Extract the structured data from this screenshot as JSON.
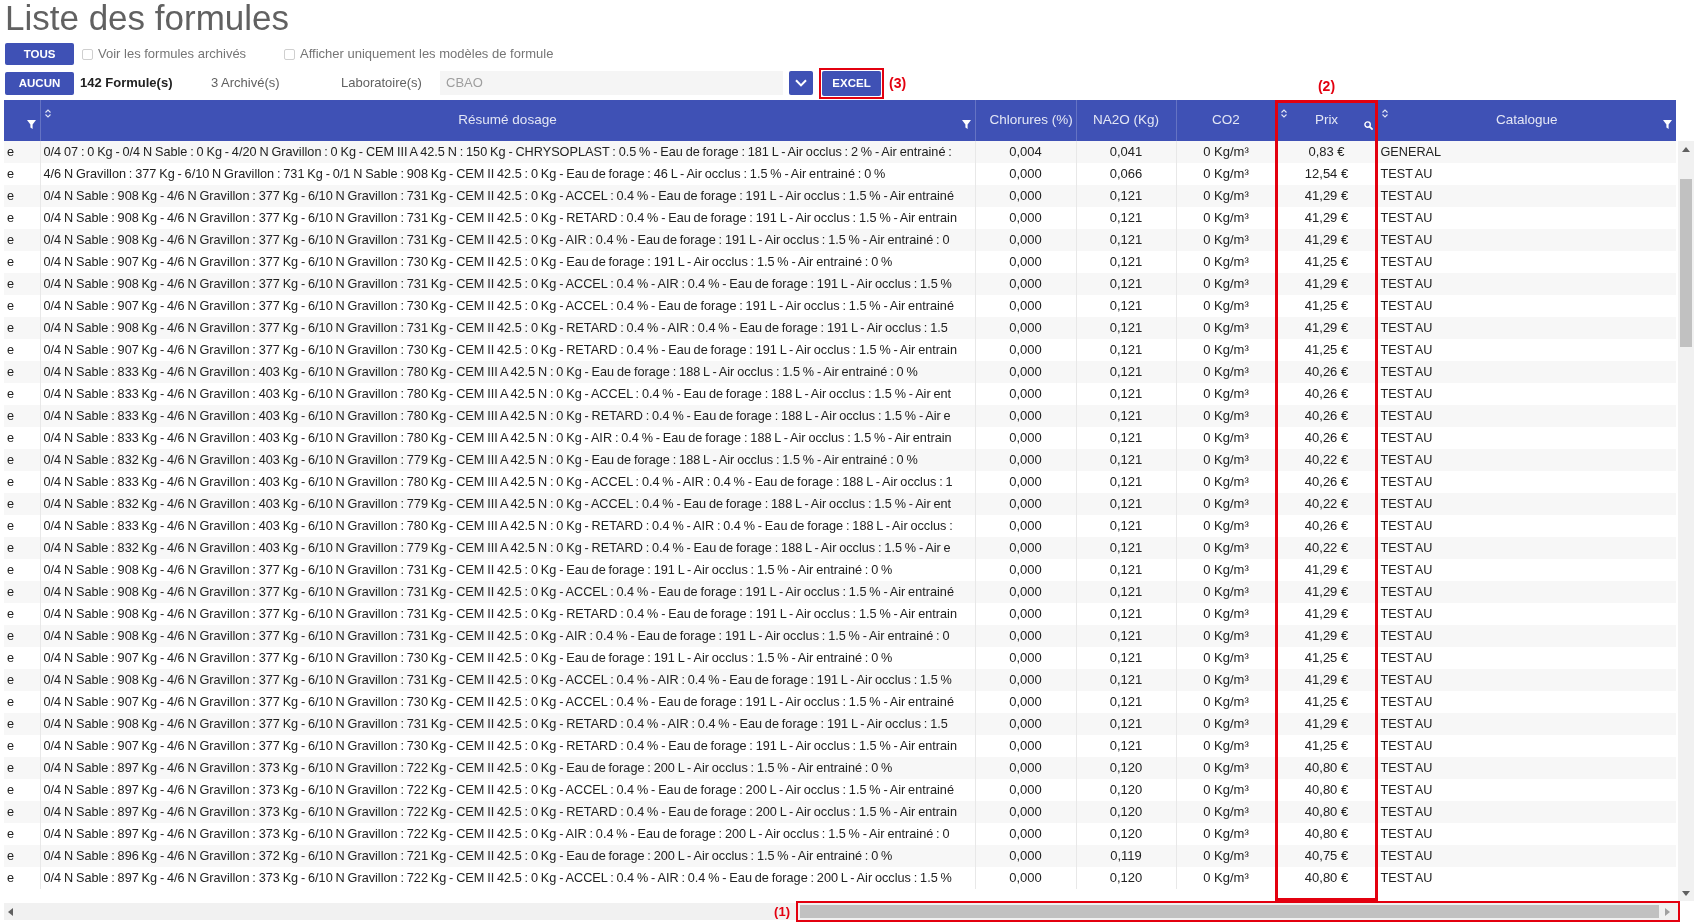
{
  "title": "Liste des formules",
  "toolbar_row_1": {
    "button": "TOUS",
    "checkboxes": [
      {
        "label": "Voir les formules archivés",
        "checked": false
      },
      {
        "label": "Afficher uniquement les modèles de formule",
        "checked": false
      }
    ]
  },
  "toolbar_row_2": {
    "button": "AUCUN",
    "formula_count": "142 Formule(s)",
    "archived_count": "3 Archivé(s)",
    "laboratory": {
      "label": "Laboratoire(s)",
      "value": "CBAO"
    },
    "export_button": {
      "label": "EXCEL",
      "annotation": "(3)"
    }
  },
  "table": {
    "columns": [
      {
        "kind": "text",
        "sortable": false,
        "filter": true,
        "search": false
      },
      {
        "label": "Résumé dosage",
        "kind": "text",
        "sortable": true,
        "filter": true,
        "search": false
      },
      {
        "label": "Chlorures (%)",
        "kind": "number",
        "sortable": false,
        "filter": false,
        "search": false
      },
      {
        "label": "NA2O (Kg)",
        "kind": "number",
        "sortable": false,
        "filter": false,
        "search": false
      },
      {
        "label": "CO2",
        "kind": "number",
        "sortable": false,
        "filter": false,
        "search": false
      },
      {
        "label": "Prix",
        "kind": "number",
        "sortable": true,
        "filter": false,
        "search": true,
        "annotation": "(2)"
      },
      {
        "label": "Catalogue",
        "kind": "text",
        "sortable": true,
        "filter": true,
        "search": false
      }
    ],
    "rows": [
      [
        "e",
        "0/4 07 : 0 Kg - 0/4 N Sable : 0 Kg - 4/20 N Gravillon : 0 Kg - CEM III A 42.5 N : 150 Kg - CHRYSOPLAST : 0.5 % - Eau de forage : 181 L - Air occlus : 2 % - Air entrainé :",
        "0,004",
        "0,041",
        "0 Kg/m³",
        "0,83 €",
        "GENERAL"
      ],
      [
        "e",
        "4/6 N Gravillon : 377 Kg - 6/10 N Gravillon : 731 Kg - 0/1 N Sable : 908 Kg - CEM II 42.5 : 0 Kg - Eau de forage : 46 L - Air occlus : 1.5 % - Air entrainé : 0 %",
        "0,000",
        "0,066",
        "0 Kg/m³",
        "12,54 €",
        "TEST AU"
      ],
      [
        "e",
        "0/4 N Sable : 908 Kg - 4/6 N Gravillon : 377 Kg - 6/10 N Gravillon : 731 Kg - CEM II 42.5 : 0 Kg - ACCEL : 0.4 % - Eau de forage : 191 L - Air occlus : 1.5 % - Air entrainé",
        "0,000",
        "0,121",
        "0 Kg/m³",
        "41,29 €",
        "TEST AU"
      ],
      [
        "e",
        "0/4 N Sable : 908 Kg - 4/6 N Gravillon : 377 Kg - 6/10 N Gravillon : 731 Kg - CEM II 42.5 : 0 Kg - RETARD : 0.4 % - Eau de forage : 191 L - Air occlus : 1.5 % - Air entrain",
        "0,000",
        "0,121",
        "0 Kg/m³",
        "41,29 €",
        "TEST AU"
      ],
      [
        "e",
        "0/4 N Sable : 908 Kg - 4/6 N Gravillon : 377 Kg - 6/10 N Gravillon : 731 Kg - CEM II 42.5 : 0 Kg - AIR : 0.4 % - Eau de forage : 191 L - Air occlus : 1.5 % - Air entrainé : 0",
        "0,000",
        "0,121",
        "0 Kg/m³",
        "41,29 €",
        "TEST AU"
      ],
      [
        "e",
        "0/4 N Sable : 907 Kg - 4/6 N Gravillon : 377 Kg - 6/10 N Gravillon : 730 Kg - CEM II 42.5 : 0 Kg - Eau de forage : 191 L - Air occlus : 1.5 % - Air entrainé : 0 %",
        "0,000",
        "0,121",
        "0 Kg/m³",
        "41,25 €",
        "TEST AU"
      ],
      [
        "e",
        "0/4 N Sable : 908 Kg - 4/6 N Gravillon : 377 Kg - 6/10 N Gravillon : 731 Kg - CEM II 42.5 : 0 Kg - ACCEL : 0.4 % - AIR : 0.4 % - Eau de forage : 191 L - Air occlus : 1.5 %",
        "0,000",
        "0,121",
        "0 Kg/m³",
        "41,29 €",
        "TEST AU"
      ],
      [
        "e",
        "0/4 N Sable : 907 Kg - 4/6 N Gravillon : 377 Kg - 6/10 N Gravillon : 730 Kg - CEM II 42.5 : 0 Kg - ACCEL : 0.4 % - Eau de forage : 191 L - Air occlus : 1.5 % - Air entrainé",
        "0,000",
        "0,121",
        "0 Kg/m³",
        "41,25 €",
        "TEST AU"
      ],
      [
        "e",
        "0/4 N Sable : 908 Kg - 4/6 N Gravillon : 377 Kg - 6/10 N Gravillon : 731 Kg - CEM II 42.5 : 0 Kg - RETARD : 0.4 % - AIR : 0.4 % - Eau de forage : 191 L - Air occlus : 1.5",
        "0,000",
        "0,121",
        "0 Kg/m³",
        "41,29 €",
        "TEST AU"
      ],
      [
        "e",
        "0/4 N Sable : 907 Kg - 4/6 N Gravillon : 377 Kg - 6/10 N Gravillon : 730 Kg - CEM II 42.5 : 0 Kg - RETARD : 0.4 % - Eau de forage : 191 L - Air occlus : 1.5 % - Air entrain",
        "0,000",
        "0,121",
        "0 Kg/m³",
        "41,25 €",
        "TEST AU"
      ],
      [
        "e",
        "0/4 N Sable : 833 Kg - 4/6 N Gravillon : 403 Kg - 6/10 N Gravillon : 780 Kg - CEM III A 42.5 N : 0 Kg - Eau de forage : 188 L - Air occlus : 1.5 % - Air entrainé : 0 %",
        "0,000",
        "0,121",
        "0 Kg/m³",
        "40,26 €",
        "TEST AU"
      ],
      [
        "e",
        "0/4 N Sable : 833 Kg - 4/6 N Gravillon : 403 Kg - 6/10 N Gravillon : 780 Kg - CEM III A 42.5 N : 0 Kg - ACCEL : 0.4 % - Eau de forage : 188 L - Air occlus : 1.5 % - Air ent",
        "0,000",
        "0,121",
        "0 Kg/m³",
        "40,26 €",
        "TEST AU"
      ],
      [
        "e",
        "0/4 N Sable : 833 Kg - 4/6 N Gravillon : 403 Kg - 6/10 N Gravillon : 780 Kg - CEM III A 42.5 N : 0 Kg - RETARD : 0.4 % - Eau de forage : 188 L - Air occlus : 1.5 % - Air e",
        "0,000",
        "0,121",
        "0 Kg/m³",
        "40,26 €",
        "TEST AU"
      ],
      [
        "e",
        "0/4 N Sable : 833 Kg - 4/6 N Gravillon : 403 Kg - 6/10 N Gravillon : 780 Kg - CEM III A 42.5 N : 0 Kg - AIR : 0.4 % - Eau de forage : 188 L - Air occlus : 1.5 % - Air entrain",
        "0,000",
        "0,121",
        "0 Kg/m³",
        "40,26 €",
        "TEST AU"
      ],
      [
        "e",
        "0/4 N Sable : 832 Kg - 4/6 N Gravillon : 403 Kg - 6/10 N Gravillon : 779 Kg - CEM III A 42.5 N : 0 Kg - Eau de forage : 188 L - Air occlus : 1.5 % - Air entrainé : 0 %",
        "0,000",
        "0,121",
        "0 Kg/m³",
        "40,22 €",
        "TEST AU"
      ],
      [
        "e",
        "0/4 N Sable : 833 Kg - 4/6 N Gravillon : 403 Kg - 6/10 N Gravillon : 780 Kg - CEM III A 42.5 N : 0 Kg - ACCEL : 0.4 % - AIR : 0.4 % - Eau de forage : 188 L - Air occlus : 1",
        "0,000",
        "0,121",
        "0 Kg/m³",
        "40,26 €",
        "TEST AU"
      ],
      [
        "e",
        "0/4 N Sable : 832 Kg - 4/6 N Gravillon : 403 Kg - 6/10 N Gravillon : 779 Kg - CEM III A 42.5 N : 0 Kg - ACCEL : 0.4 % - Eau de forage : 188 L - Air occlus : 1.5 % - Air ent",
        "0,000",
        "0,121",
        "0 Kg/m³",
        "40,22 €",
        "TEST AU"
      ],
      [
        "e",
        "0/4 N Sable : 833 Kg - 4/6 N Gravillon : 403 Kg - 6/10 N Gravillon : 780 Kg - CEM III A 42.5 N : 0 Kg - RETARD : 0.4 % - AIR : 0.4 % - Eau de forage : 188 L - Air occlus :",
        "0,000",
        "0,121",
        "0 Kg/m³",
        "40,26 €",
        "TEST AU"
      ],
      [
        "e",
        "0/4 N Sable : 832 Kg - 4/6 N Gravillon : 403 Kg - 6/10 N Gravillon : 779 Kg - CEM III A 42.5 N : 0 Kg - RETARD : 0.4 % - Eau de forage : 188 L - Air occlus : 1.5 % - Air e",
        "0,000",
        "0,121",
        "0 Kg/m³",
        "40,22 €",
        "TEST AU"
      ],
      [
        "e",
        "0/4 N Sable : 908 Kg - 4/6 N Gravillon : 377 Kg - 6/10 N Gravillon : 731 Kg - CEM II 42.5 : 0 Kg - Eau de forage : 191 L - Air occlus : 1.5 % - Air entrainé : 0 %",
        "0,000",
        "0,121",
        "0 Kg/m³",
        "41,29 €",
        "TEST AU"
      ],
      [
        "e",
        "0/4 N Sable : 908 Kg - 4/6 N Gravillon : 377 Kg - 6/10 N Gravillon : 731 Kg - CEM II 42.5 : 0 Kg - ACCEL : 0.4 % - Eau de forage : 191 L - Air occlus : 1.5 % - Air entrainé",
        "0,000",
        "0,121",
        "0 Kg/m³",
        "41,29 €",
        "TEST AU"
      ],
      [
        "e",
        "0/4 N Sable : 908 Kg - 4/6 N Gravillon : 377 Kg - 6/10 N Gravillon : 731 Kg - CEM II 42.5 : 0 Kg - RETARD : 0.4 % - Eau de forage : 191 L - Air occlus : 1.5 % - Air entrain",
        "0,000",
        "0,121",
        "0 Kg/m³",
        "41,29 €",
        "TEST AU"
      ],
      [
        "e",
        "0/4 N Sable : 908 Kg - 4/6 N Gravillon : 377 Kg - 6/10 N Gravillon : 731 Kg - CEM II 42.5 : 0 Kg - AIR : 0.4 % - Eau de forage : 191 L - Air occlus : 1.5 % - Air entrainé : 0",
        "0,000",
        "0,121",
        "0 Kg/m³",
        "41,29 €",
        "TEST AU"
      ],
      [
        "e",
        "0/4 N Sable : 907 Kg - 4/6 N Gravillon : 377 Kg - 6/10 N Gravillon : 730 Kg - CEM II 42.5 : 0 Kg - Eau de forage : 191 L - Air occlus : 1.5 % - Air entrainé : 0 %",
        "0,000",
        "0,121",
        "0 Kg/m³",
        "41,25 €",
        "TEST AU"
      ],
      [
        "e",
        "0/4 N Sable : 908 Kg - 4/6 N Gravillon : 377 Kg - 6/10 N Gravillon : 731 Kg - CEM II 42.5 : 0 Kg - ACCEL : 0.4 % - AIR : 0.4 % - Eau de forage : 191 L - Air occlus : 1.5 %",
        "0,000",
        "0,121",
        "0 Kg/m³",
        "41,29 €",
        "TEST AU"
      ],
      [
        "e",
        "0/4 N Sable : 907 Kg - 4/6 N Gravillon : 377 Kg - 6/10 N Gravillon : 730 Kg - CEM II 42.5 : 0 Kg - ACCEL : 0.4 % - Eau de forage : 191 L - Air occlus : 1.5 % - Air entrainé",
        "0,000",
        "0,121",
        "0 Kg/m³",
        "41,25 €",
        "TEST AU"
      ],
      [
        "e",
        "0/4 N Sable : 908 Kg - 4/6 N Gravillon : 377 Kg - 6/10 N Gravillon : 731 Kg - CEM II 42.5 : 0 Kg - RETARD : 0.4 % - AIR : 0.4 % - Eau de forage : 191 L - Air occlus : 1.5",
        "0,000",
        "0,121",
        "0 Kg/m³",
        "41,29 €",
        "TEST AU"
      ],
      [
        "e",
        "0/4 N Sable : 907 Kg - 4/6 N Gravillon : 377 Kg - 6/10 N Gravillon : 730 Kg - CEM II 42.5 : 0 Kg - RETARD : 0.4 % - Eau de forage : 191 L - Air occlus : 1.5 % - Air entrain",
        "0,000",
        "0,121",
        "0 Kg/m³",
        "41,25 €",
        "TEST AU"
      ],
      [
        "e",
        "0/4 N Sable : 897 Kg - 4/6 N Gravillon : 373 Kg - 6/10 N Gravillon : 722 Kg - CEM II 42.5 : 0 Kg - Eau de forage : 200 L - Air occlus : 1.5 % - Air entrainé : 0 %",
        "0,000",
        "0,120",
        "0 Kg/m³",
        "40,80 €",
        "TEST AU"
      ],
      [
        "e",
        "0/4 N Sable : 897 Kg - 4/6 N Gravillon : 373 Kg - 6/10 N Gravillon : 722 Kg - CEM II 42.5 : 0 Kg - ACCEL : 0.4 % - Eau de forage : 200 L - Air occlus : 1.5 % - Air entrainé",
        "0,000",
        "0,120",
        "0 Kg/m³",
        "40,80 €",
        "TEST AU"
      ],
      [
        "e",
        "0/4 N Sable : 897 Kg - 4/6 N Gravillon : 373 Kg - 6/10 N Gravillon : 722 Kg - CEM II 42.5 : 0 Kg - RETARD : 0.4 % - Eau de forage : 200 L - Air occlus : 1.5 % - Air entrain",
        "0,000",
        "0,120",
        "0 Kg/m³",
        "40,80 €",
        "TEST AU"
      ],
      [
        "e",
        "0/4 N Sable : 897 Kg - 4/6 N Gravillon : 373 Kg - 6/10 N Gravillon : 722 Kg - CEM II 42.5 : 0 Kg - AIR : 0.4 % - Eau de forage : 200 L - Air occlus : 1.5 % - Air entrainé : 0",
        "0,000",
        "0,120",
        "0 Kg/m³",
        "40,80 €",
        "TEST AU"
      ],
      [
        "e",
        "0/4 N Sable : 896 Kg - 4/6 N Gravillon : 372 Kg - 6/10 N Gravillon : 721 Kg - CEM II 42.5 : 0 Kg - Eau de forage : 200 L - Air occlus : 1.5 % - Air entrainé : 0 %",
        "0,000",
        "0,119",
        "0 Kg/m³",
        "40,75 €",
        "TEST AU"
      ],
      [
        "e",
        "0/4 N Sable : 897 Kg - 4/6 N Gravillon : 373 Kg - 6/10 N Gravillon : 722 Kg - CEM II 42.5 : 0 Kg - ACCEL : 0.4 % - AIR : 0.4 % - Eau de forage : 200 L - Air occlus : 1.5 %",
        "0,000",
        "0,120",
        "0 Kg/m³",
        "40,80 €",
        "TEST AU"
      ]
    ]
  },
  "horizontal_scrollbar": {
    "annotation": "(1)"
  }
}
